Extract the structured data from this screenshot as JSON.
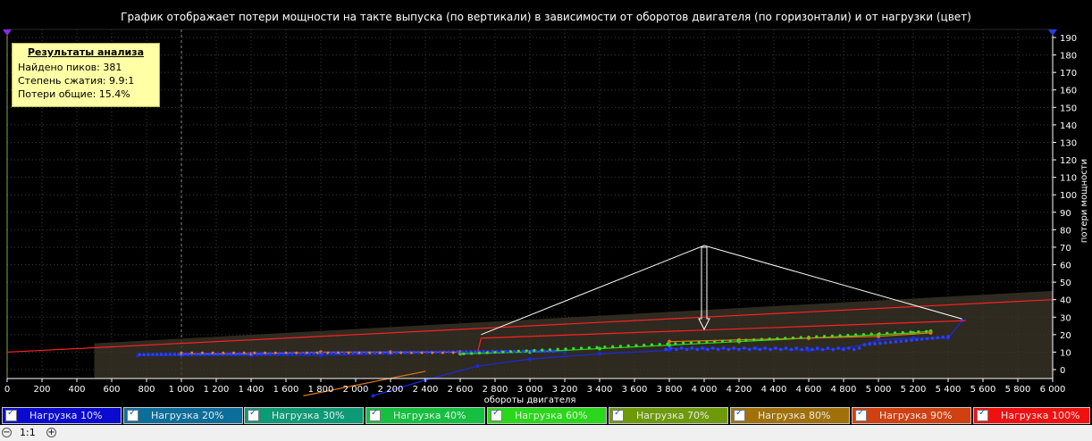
{
  "title": "График отображает потери мощности на такте выпуска (по вертикали) в зависимости от оборотов двигателя (по горизонтали) и от нагрузки (цвет)",
  "results": {
    "heading": "Результаты анализа",
    "peaks": "Найдено пиков: 381",
    "compression": "Степень сжатия: 9.9:1",
    "losses": "Потери общие: 15.4%"
  },
  "legend": [
    {
      "label": "Нагрузка 10%",
      "color": "#0a0ad0"
    },
    {
      "label": "Нагрузка 20%",
      "color": "#0c6e9a"
    },
    {
      "label": "Нагрузка 30%",
      "color": "#0d9a76"
    },
    {
      "label": "Нагрузка 40%",
      "color": "#14c040"
    },
    {
      "label": "Нагрузка 60%",
      "color": "#2ad71a"
    },
    {
      "label": "Нагрузка 70%",
      "color": "#6e9a0a"
    },
    {
      "label": "Нагрузка 80%",
      "color": "#a0700a"
    },
    {
      "label": "Нагрузка 90%",
      "color": "#d04010"
    },
    {
      "label": "Нагрузка 100%",
      "color": "#f01010"
    }
  ],
  "zoom": {
    "label": "1:1"
  },
  "chart_data": {
    "type": "scatter",
    "xlabel": "обороты двигателя",
    "ylabel": "потери мощности",
    "xlim": [
      0,
      6000
    ],
    "ylim": [
      -15,
      190
    ],
    "x_ticks": [
      0,
      200,
      400,
      600,
      800,
      1000,
      1200,
      1400,
      1600,
      1800,
      2000,
      2200,
      2400,
      2600,
      2800,
      3000,
      3200,
      3400,
      3600,
      3800,
      4000,
      4200,
      4400,
      4600,
      4800,
      5000,
      5200,
      5400,
      5600,
      5800,
      6000
    ],
    "x_tick_labels": [
      "0",
      "200",
      "400",
      "600",
      "800",
      "1 000",
      "1 200",
      "1 400",
      "1 600",
      "1 800",
      "2 000",
      "2 200",
      "2 400",
      "2 600",
      "2 800",
      "3 000",
      "3 200",
      "3 400",
      "3 600",
      "3 800",
      "4 000",
      "4 200",
      "4 400",
      "4 600",
      "4 800",
      "5 000",
      "5 200",
      "5 400",
      "5 600",
      "5 800",
      "6 000"
    ],
    "y_ticks": [
      0,
      10,
      20,
      30,
      40,
      50,
      60,
      70,
      80,
      90,
      100,
      110,
      120,
      130,
      140,
      150,
      160,
      170,
      180,
      190
    ],
    "grid": true,
    "series": [
      {
        "color": "#1a2ae0",
        "points": [
          [
            750,
            8
          ],
          [
            1000,
            8
          ],
          [
            1400,
            8
          ],
          [
            1800,
            8
          ],
          [
            2200,
            9
          ],
          [
            2600,
            10
          ],
          [
            3000,
            10
          ],
          [
            3200,
            10
          ]
        ]
      },
      {
        "color": "#1a2ae0",
        "points": [
          [
            3800,
            12
          ],
          [
            4000,
            12
          ],
          [
            4300,
            12
          ],
          [
            4600,
            11
          ],
          [
            4800,
            12
          ],
          [
            4950,
            15
          ],
          [
            5000,
            17
          ],
          [
            5200,
            18
          ],
          [
            5400,
            18
          ],
          [
            5480,
            28
          ]
        ]
      },
      {
        "color": "#1a2ae0",
        "points": [
          [
            2100,
            -15
          ],
          [
            2400,
            -6
          ],
          [
            2700,
            2
          ],
          [
            3000,
            6
          ],
          [
            3400,
            9
          ],
          [
            3800,
            11
          ]
        ]
      },
      {
        "color": "#2ad71a",
        "points": [
          [
            2600,
            9
          ],
          [
            3000,
            10
          ],
          [
            3400,
            12
          ],
          [
            3800,
            14
          ],
          [
            4200,
            16
          ],
          [
            4600,
            18
          ],
          [
            5000,
            20
          ],
          [
            5200,
            21
          ],
          [
            5300,
            22
          ]
        ]
      },
      {
        "color": "#e07818",
        "points": [
          [
            1000,
            9
          ],
          [
            1400,
            9
          ],
          [
            1800,
            10
          ],
          [
            2200,
            10
          ],
          [
            2600,
            10
          ]
        ]
      },
      {
        "color": "#e07818",
        "points": [
          [
            1700,
            -15
          ],
          [
            2400,
            -1
          ]
        ]
      },
      {
        "color": "#e07818",
        "points": [
          [
            3800,
            16
          ],
          [
            4200,
            17
          ],
          [
            4600,
            18
          ],
          [
            5000,
            19
          ],
          [
            5300,
            21
          ]
        ]
      },
      {
        "color": "#ff2020",
        "points": [
          [
            0,
            10
          ],
          [
            6000,
            40
          ]
        ]
      },
      {
        "color": "#ff2020",
        "points": [
          [
            2700,
            10
          ],
          [
            2720,
            18
          ]
        ]
      },
      {
        "color": "#ff2020",
        "points": [
          [
            2720,
            18
          ],
          [
            5500,
            28
          ]
        ]
      }
    ],
    "outline": [
      [
        2720,
        20
      ],
      [
        4000,
        71
      ],
      [
        5480,
        29
      ],
      [
        5480,
        29
      ]
    ],
    "arrow": {
      "x": 4000,
      "y_from": 70,
      "y_to": 23
    }
  }
}
